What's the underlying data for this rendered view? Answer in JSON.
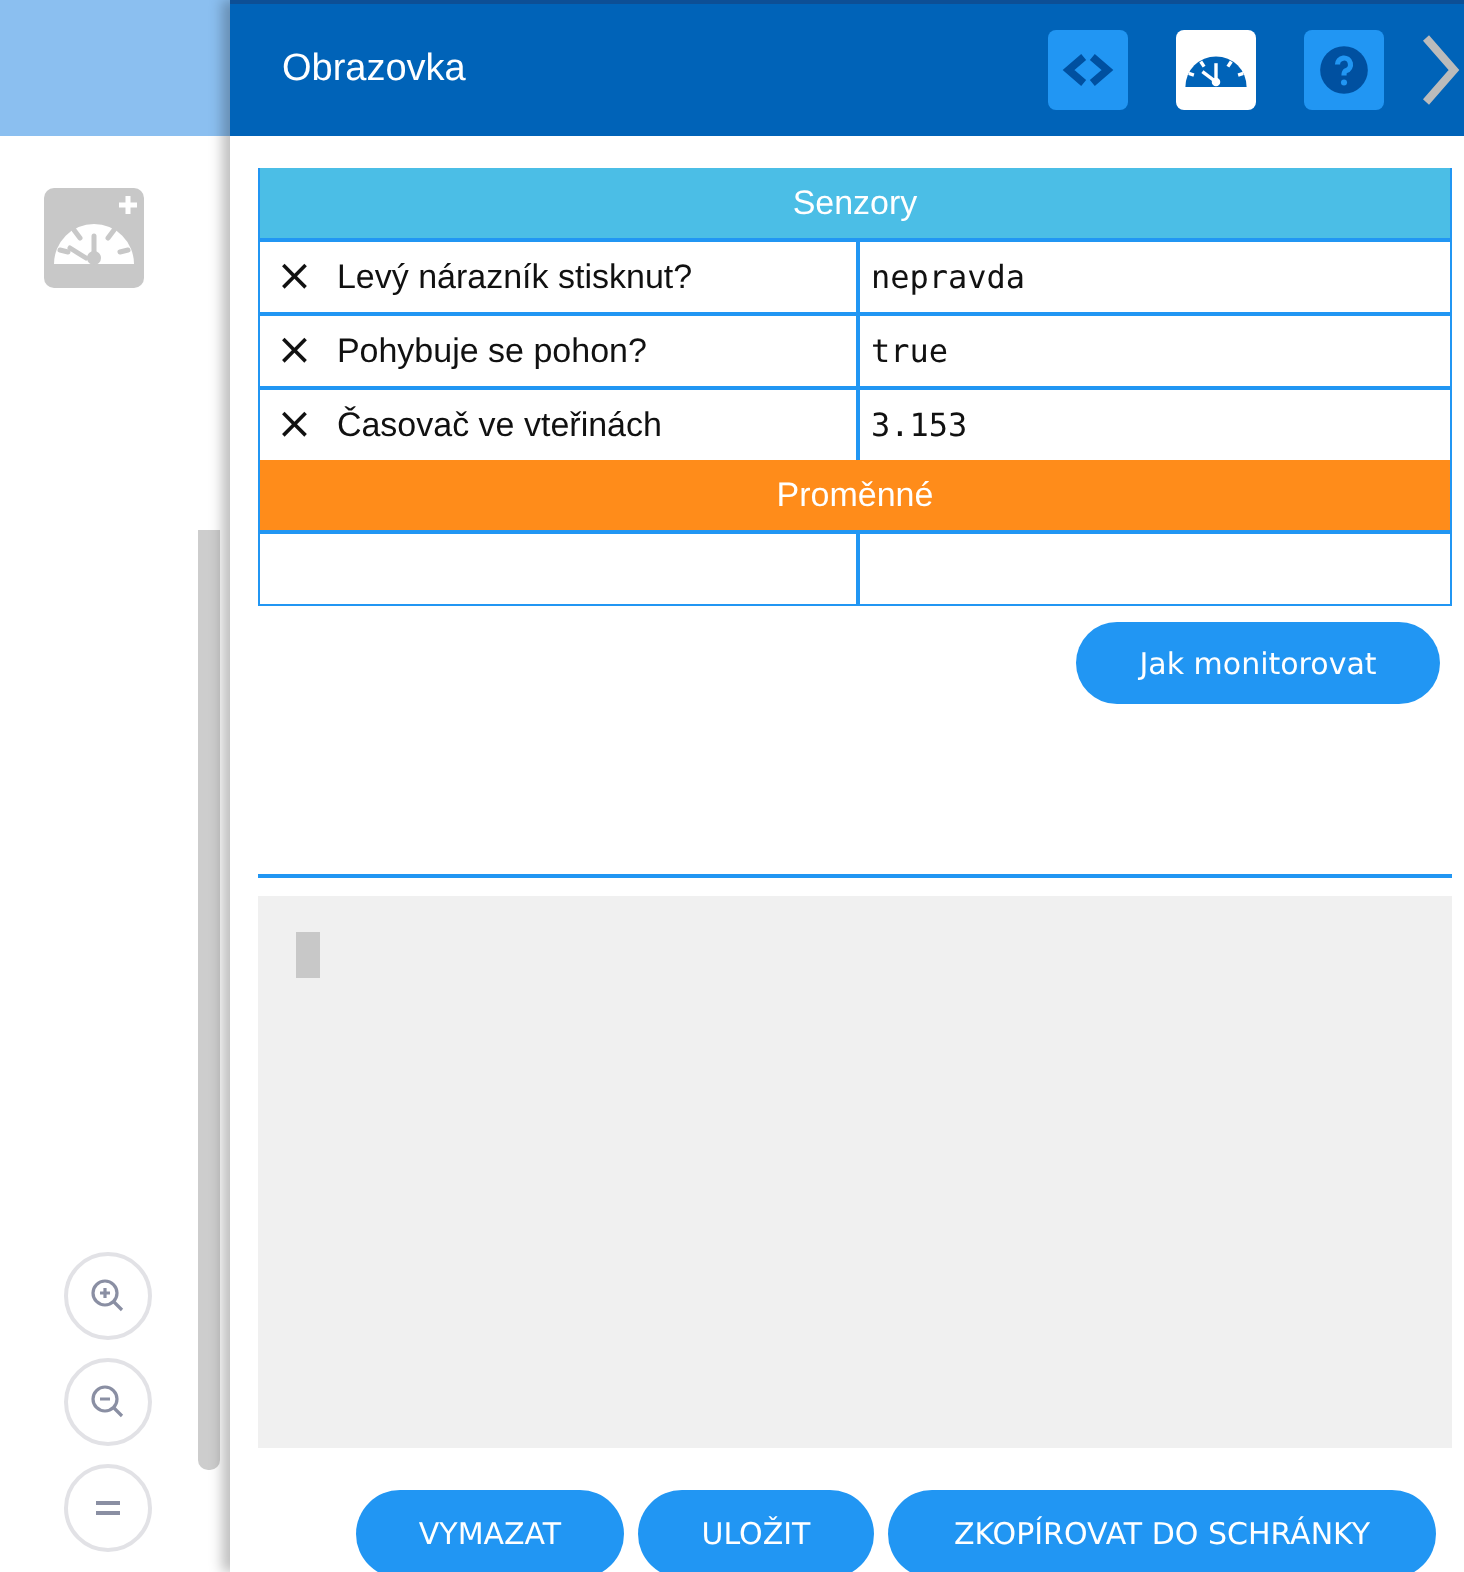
{
  "header": {
    "title": "Obrazovka",
    "tools": [
      {
        "kind": "code",
        "selected": false
      },
      {
        "kind": "gauge",
        "selected": true
      },
      {
        "kind": "help",
        "selected": false
      }
    ]
  },
  "sections": [
    {
      "title": "Senzory",
      "color": "#4bbee6",
      "rows": [
        {
          "remove": "×",
          "label": "Levý nárazník stisknut?",
          "value": "nepravda"
        },
        {
          "remove": "×",
          "label": "Pohybuje se pohon?",
          "value": "true"
        },
        {
          "remove": "×",
          "label": "Časovač ve vteřinách",
          "value": "3.153"
        }
      ]
    },
    {
      "title": "Proměnné",
      "color": "#ff8c1a",
      "rows": [
        {}
      ]
    }
  ],
  "help_button": "Jak monitorovat",
  "console": {
    "cursor": true
  },
  "actions": [
    "VYMAZAT",
    "ULOŽIT",
    "ZKOPÍROVAT DO SCHRÁNKY"
  ]
}
